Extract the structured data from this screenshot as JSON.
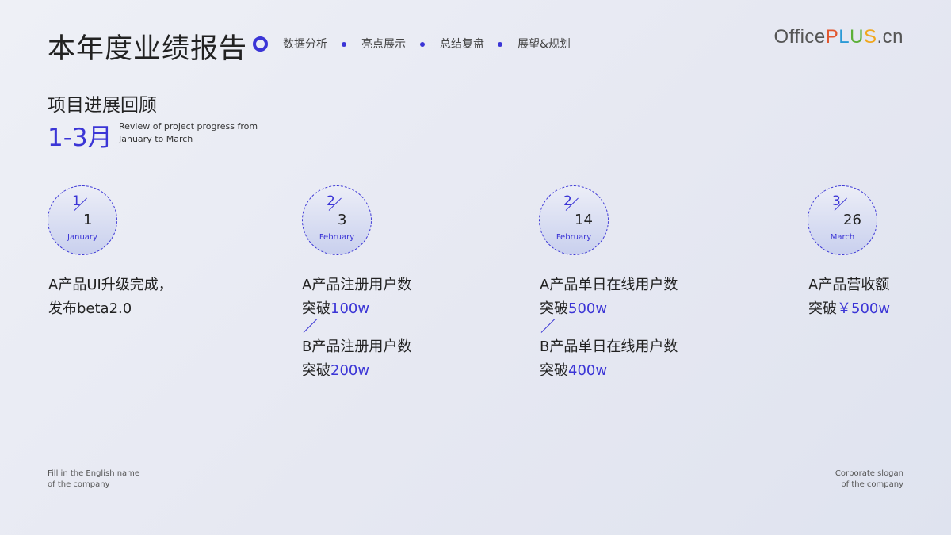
{
  "header": {
    "title": "本年度业绩报告",
    "nav": [
      "数据分析",
      "亮点展示",
      "总结复盘",
      "展望&规划"
    ],
    "logo": {
      "office": "Office",
      "p": "P",
      "l": "L",
      "u": "U",
      "s": "S",
      "cn": ".cn"
    }
  },
  "section": {
    "title": "项目进展回顾",
    "range": "1-3月",
    "subtitle_line1": "Review of project progress from",
    "subtitle_line2": "January to March"
  },
  "timeline": [
    {
      "month": "1",
      "day": "1",
      "month_name": "January",
      "lines": [
        {
          "a": "A产品UI升级完成，",
          "b": ""
        },
        {
          "a": "发布beta2.0",
          "b": ""
        }
      ]
    },
    {
      "month": "2",
      "day": "3",
      "month_name": "February",
      "lines": [
        {
          "a": "A产品注册用户数",
          "b": ""
        },
        {
          "a": "突破",
          "b": "100w"
        },
        {
          "a": "B产品注册用户数",
          "b": ""
        },
        {
          "a": "突破",
          "b": "200w"
        }
      ]
    },
    {
      "month": "2",
      "day": "14",
      "month_name": "February",
      "lines": [
        {
          "a": "A产品单日在线用户数",
          "b": ""
        },
        {
          "a": "突破",
          "b": "500w"
        },
        {
          "a": "B产品单日在线用户数",
          "b": ""
        },
        {
          "a": "突破",
          "b": "400w"
        }
      ]
    },
    {
      "month": "3",
      "day": "26",
      "month_name": "March",
      "lines": [
        {
          "a": "A产品营收额",
          "b": ""
        },
        {
          "a": "突破",
          "b": "￥500w"
        }
      ]
    }
  ],
  "footer": {
    "left_line1": "Fill in the English name",
    "left_line2": "of the company",
    "right_line1": "Corporate slogan",
    "right_line2": "of the company"
  },
  "colors": {
    "accent": "#3b35d6",
    "text": "#222222"
  }
}
